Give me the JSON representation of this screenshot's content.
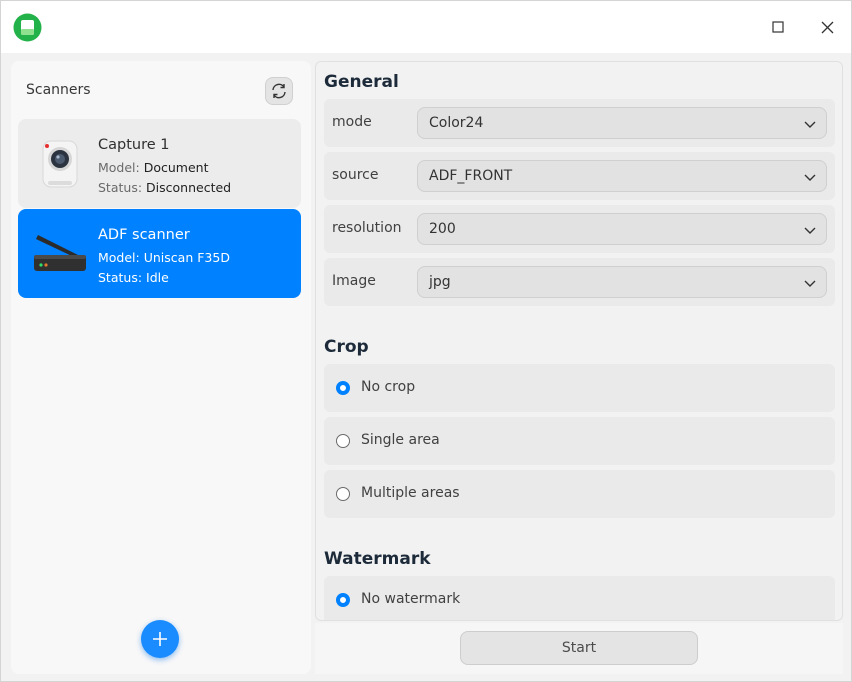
{
  "titlebar": {
    "icons": {
      "app": "scanner-app-icon",
      "maximize": "maximize-icon",
      "close": "close-icon"
    }
  },
  "sidebar": {
    "title": "Scanners",
    "refresh_icon": "refresh-icon",
    "add_icon": "plus-icon",
    "scanners": [
      {
        "name": "Capture 1",
        "model_label": "Model:",
        "model": "Document",
        "status_label": "Status:",
        "status": "Disconnected",
        "icon": "webcam-icon",
        "selected": false
      },
      {
        "name": "ADF scanner",
        "model_label": "Model:",
        "model": "Uniscan F35D",
        "status_label": "Status:",
        "status": "Idle",
        "icon": "flatbed-scanner-icon",
        "selected": true
      }
    ]
  },
  "settings": {
    "general": {
      "title": "General",
      "rows": [
        {
          "label": "mode",
          "value": "Color24"
        },
        {
          "label": "source",
          "value": "ADF_FRONT"
        },
        {
          "label": "resolution",
          "value": "200"
        },
        {
          "label": "Image",
          "value": "jpg"
        }
      ]
    },
    "crop": {
      "title": "Crop",
      "options": [
        {
          "label": "No crop",
          "checked": true
        },
        {
          "label": "Single area",
          "checked": false
        },
        {
          "label": "Multiple areas",
          "checked": false
        }
      ]
    },
    "watermark": {
      "title": "Watermark",
      "options": [
        {
          "label": "No watermark",
          "checked": true
        }
      ]
    }
  },
  "footer": {
    "start_label": "Start"
  },
  "colors": {
    "accent": "#0081ff",
    "selected_bg": "#0081ff",
    "panel_bg": "#f8f8f8"
  }
}
